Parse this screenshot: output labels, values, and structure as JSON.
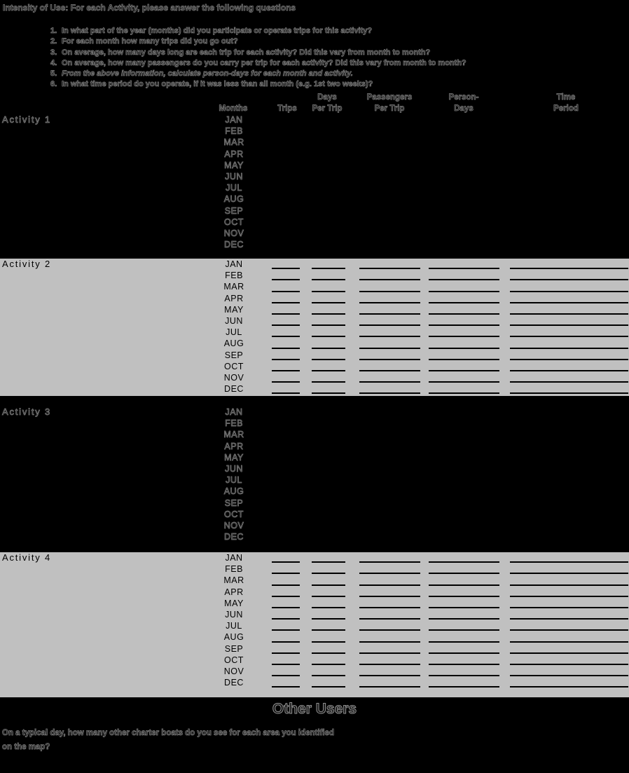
{
  "header": {
    "title": "Intensity of Use:  For each Activity, please answer the following questions",
    "questions": [
      {
        "num": "1.",
        "text": "In what part of the year (months) did you participate or operate trips for this activity?"
      },
      {
        "num": "2.",
        "text": "For each month how many trips did you go out?"
      },
      {
        "num": "3.",
        "text": "On average, how many days long are each trip for each activity? Did this vary from month to month?"
      },
      {
        "num": "4.",
        "text": "On average, how many passengers do you carry per trip for each activity? Did this vary from month to month?"
      },
      {
        "num": "5.",
        "text": "From the above information, calculate person-days for each month and activity."
      },
      {
        "num": "6.",
        "text": "In what time period do you operate, if it was less than all month (e.g. 1st two weeks)?"
      }
    ]
  },
  "table": {
    "columns": [
      {
        "line1": "",
        "line2": "Months"
      },
      {
        "line1": "",
        "line2": "Trips"
      },
      {
        "line1": "Days",
        "line2": "Per Trip"
      },
      {
        "line1": "Passengers",
        "line2": "Per Trip"
      },
      {
        "line1": "Person-",
        "line2": "Days"
      },
      {
        "line1": "Time",
        "line2": "Period"
      }
    ],
    "months": [
      "JAN",
      "FEB",
      "MAR",
      "APR",
      "MAY",
      "JUN",
      "JUL",
      "AUG",
      "SEP",
      "OCT",
      "NOV",
      "DEC"
    ]
  },
  "activities": [
    {
      "label": "Activity 1"
    },
    {
      "label": "Activity 2"
    },
    {
      "label": "Activity 3"
    },
    {
      "label": "Activity 4"
    }
  ],
  "other_users": {
    "heading": "Other Users",
    "question": "On a typical day, how many other charter boats do you see for each area you identified on the map?"
  },
  "colors": {
    "page_background": "#000000",
    "section_background": "#c0c0c0",
    "field_line": "#000000"
  }
}
